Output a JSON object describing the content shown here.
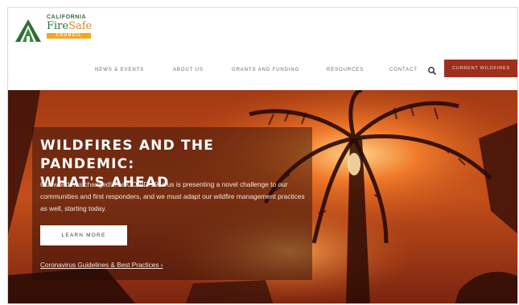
{
  "logo": {
    "line1": "CALIFORNIA",
    "fire": "Fire",
    "safe": "Safe",
    "line3": "COUNCIL"
  },
  "nav": {
    "items": [
      {
        "label": "NEWS & EVENTS"
      },
      {
        "label": "ABOUT US"
      },
      {
        "label": "GRANTS AND FUNDING"
      },
      {
        "label": "RESOURCES"
      },
      {
        "label": "CONTACT"
      }
    ],
    "search_icon": "search-icon",
    "cta_label": "CURRENT WILDFIRES"
  },
  "colors": {
    "accent": "#9e2f1d",
    "logo_green": "#2f6f35",
    "logo_orange": "#e08a1c"
  },
  "hero": {
    "headline_line1": "WILDFIRES AND THE PANDEMIC:",
    "headline_line2": "WHAT'S AHEAD",
    "body": "Our world has changed! The COVID-19 virus is presenting a novel challenge to our communities and first responders, and we must adapt our wildfire management practices as well, starting today.",
    "button_label": "LEARN MORE",
    "link_label": "Coronavirus Guidelines & Best Practices ›"
  }
}
